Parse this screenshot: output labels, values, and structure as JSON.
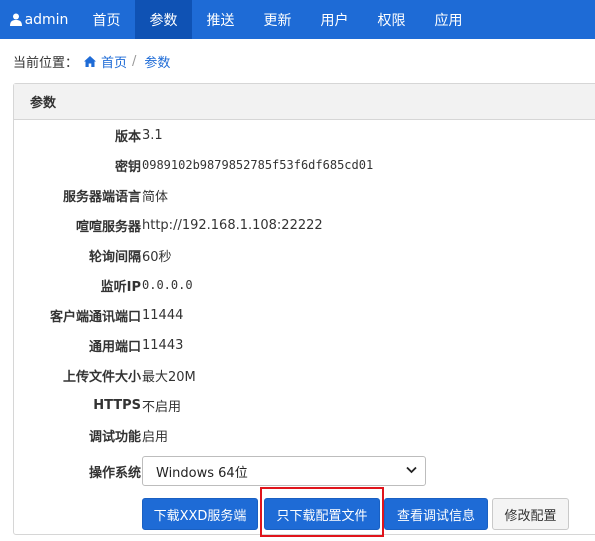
{
  "navbar": {
    "brand": "admin",
    "items": [
      "首页",
      "参数",
      "推送",
      "更新",
      "用户",
      "权限",
      "应用"
    ],
    "active_index": 1,
    "color": "#1e6bd6",
    "active_color": "#0f52b4"
  },
  "breadcrumb": {
    "prefix": "当前位置：",
    "home": "首页",
    "separator": "/",
    "current": "参数"
  },
  "panel": {
    "title": "参数",
    "rows": [
      {
        "label": "版本",
        "value": "3.1"
      },
      {
        "label": "密钥",
        "value": "0989102b9879852785f53f6df685cd01"
      },
      {
        "label": "服务器端语言",
        "value": "简体"
      },
      {
        "label": "喧喧服务器",
        "value": "http://192.168.1.108:22222"
      },
      {
        "label": "轮询间隔",
        "value": "60秒"
      },
      {
        "label": "监听IP",
        "value": "0.0.0.0"
      },
      {
        "label": "客户端通讯端口",
        "value": "11444"
      },
      {
        "label": "通用端口",
        "value": "11443"
      },
      {
        "label": "上传文件大小",
        "value": "最大20M"
      },
      {
        "label": "HTTPS",
        "value": "不启用"
      },
      {
        "label": "调试功能",
        "value": "启用"
      }
    ],
    "os": {
      "label": "操作系统",
      "selected": "Windows 64位"
    }
  },
  "buttons": {
    "download_server": "下载XXD服务端",
    "download_config": "只下载配置文件",
    "view_debug": "查看调试信息",
    "edit_config": "修改配置"
  },
  "highlight_color": "#e0141b"
}
